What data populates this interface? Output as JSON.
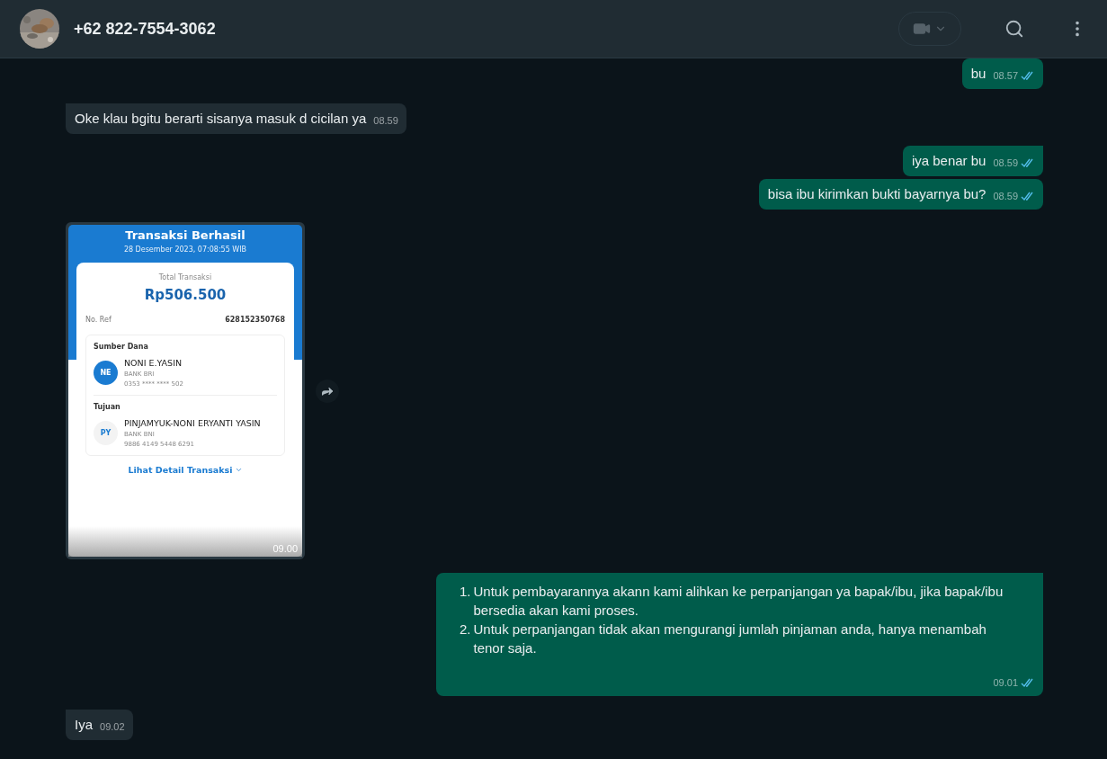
{
  "header": {
    "title": "+62 822-7554-3062"
  },
  "messages": [
    {
      "kind": "text",
      "outgoing": true,
      "text": "bu",
      "time": "08.57",
      "read": true
    },
    {
      "kind": "text",
      "outgoing": false,
      "text": "Oke klau bgitu berarti sisanya masuk d cicilan ya",
      "time": "08.59",
      "tail": true
    },
    {
      "kind": "text",
      "outgoing": true,
      "text": "iya benar bu",
      "time": "08.59",
      "read": true,
      "tail": true
    },
    {
      "kind": "text",
      "outgoing": true,
      "text": "bisa ibu kirimkan bukti bayarnya bu?",
      "time": "08.59",
      "read": true
    },
    {
      "kind": "receipt",
      "outgoing": false,
      "time": "09.00",
      "receipt": {
        "title": "Transaksi Berhasil",
        "date": "28 Desember 2023, 07:08:55 WIB",
        "total_label": "Total Transaksi",
        "total": "Rp506.500",
        "ref_label": "No. Ref",
        "ref": "628152350768",
        "parties": [
          {
            "label": "Sumber Dana",
            "initials": "NE",
            "name": "NONI E.YASIN",
            "bank": "BANK BRI",
            "account": "0353 **** **** 502",
            "filled": true
          },
          {
            "label": "Tujuan",
            "initials": "PY",
            "name": "PINJAMYUK-NONI ERYANTI YASIN",
            "bank": "BANK BNI",
            "account": "9886 4149 5448 6291",
            "filled": false
          }
        ],
        "link": "Lihat Detail Transaksi"
      }
    },
    {
      "kind": "list",
      "outgoing": true,
      "items": [
        {
          "marker": "1.",
          "text": "Untuk pembayarannya akann kami alihkan ke perpanjangan ya bapak/ibu, jika bapak/ibu bersedia akan kami proses."
        },
        {
          "marker": "2.",
          "text": "Untuk perpanjangan tidak akan mengurangi jumlah pinjaman anda, hanya menambah tenor saja."
        }
      ],
      "time": "09.01",
      "read": true,
      "tail": true
    },
    {
      "kind": "text",
      "outgoing": false,
      "text": "Iya",
      "time": "09.02",
      "tail": true
    }
  ]
}
